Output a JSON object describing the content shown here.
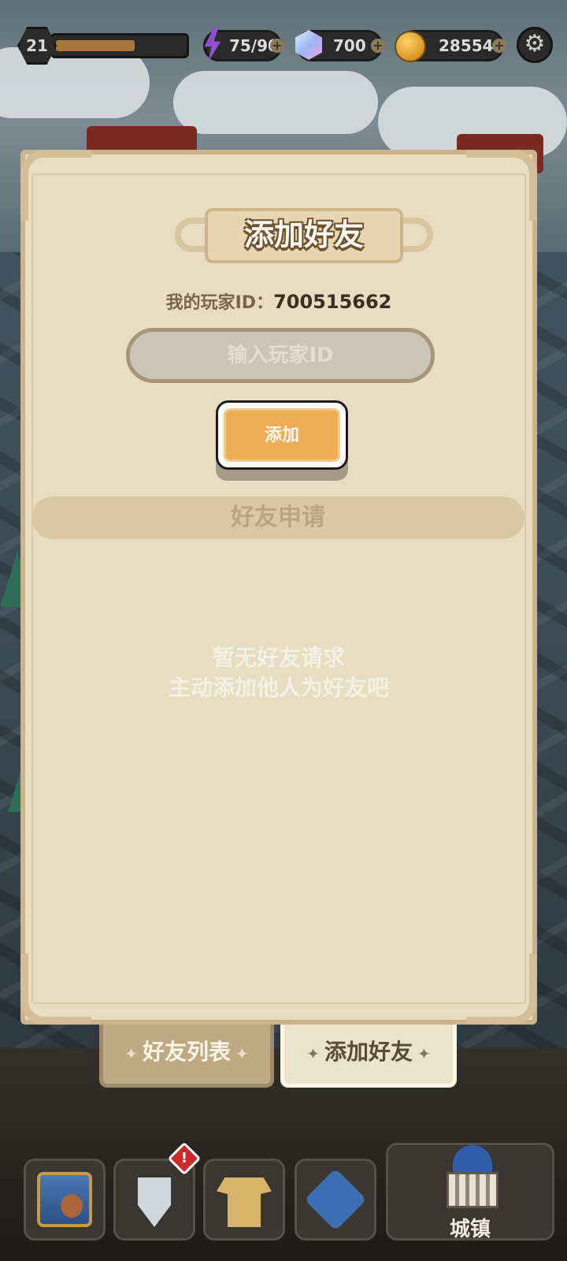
{
  "status": {
    "level": "21",
    "xp_fraction": 0.62,
    "energy": "75/90",
    "gems": "700",
    "coins": "28554"
  },
  "panel": {
    "title": "添加好友",
    "my_id_label": "我的玩家ID：",
    "my_id_value": "700515662",
    "input_placeholder": "输入玩家ID",
    "add_button": "添加",
    "section_title": "好友申请",
    "empty_line1": "暂无好友请求",
    "empty_line2": "主动添加他人为好友吧"
  },
  "tabs": [
    {
      "label": "好友列表",
      "active": false
    },
    {
      "label": "添加好友",
      "active": true
    }
  ],
  "bottom_nav": {
    "alert_mark": "!",
    "town_label": "城镇"
  },
  "icons": [
    "lightning-icon",
    "gem-icon",
    "coin-icon",
    "gear-icon",
    "chest-icon",
    "sword-icon",
    "armor-icon",
    "map-icon",
    "town-hall-icon"
  ],
  "colors": {
    "panel_bg": "#e8ddc0",
    "add_button": "#efad56",
    "alert": "#cf2a2a"
  }
}
